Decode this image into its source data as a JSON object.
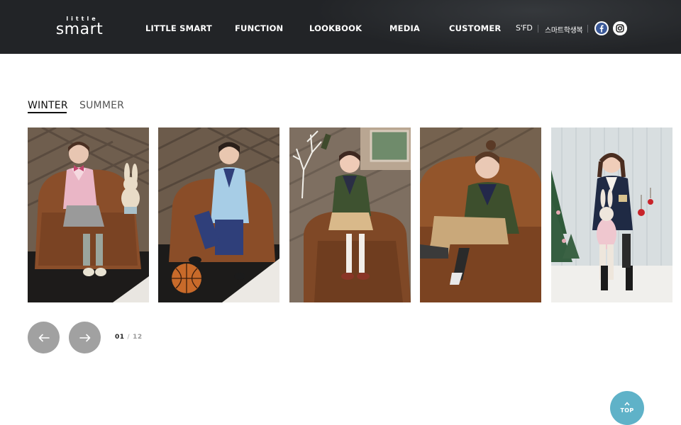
{
  "header": {
    "logo": {
      "small": "little",
      "main": "smart"
    },
    "nav": [
      "LITTLE SMART",
      "FUNCTION",
      "LOOKBOOK",
      "MEDIA",
      "CUSTOMER"
    ],
    "brand_link": "S'FD",
    "kr_link": "스마트학생복",
    "social": [
      "facebook-icon",
      "instagram-icon"
    ]
  },
  "tabs": [
    {
      "label": "WINTER",
      "active": true
    },
    {
      "label": "SUMMER",
      "active": false
    }
  ],
  "gallery": {
    "photos": [
      {
        "subject": "girl in pink blazer seated in leather armchair with plush bunny"
      },
      {
        "subject": "boy in light blue blazer with basketball in leather armchair"
      },
      {
        "subject": "girl in green plaid blazer on leather sofa with white branches"
      },
      {
        "subject": "toddler in green plaid blazer lounging in leather armchair"
      },
      {
        "subject": "girl in navy blazer holding plush bunny by christmas tree"
      }
    ]
  },
  "pager": {
    "current": "01",
    "separator": "/",
    "total": "12"
  },
  "controls": {
    "prev_icon": "arrow-left-icon",
    "next_icon": "arrow-right-icon"
  },
  "top_button": {
    "label": "TOP"
  },
  "colors": {
    "header_bg": "#222427",
    "arrow_button": "#a1a1a1",
    "top_button": "#5fb2c8",
    "facebook": "#3b5998"
  }
}
